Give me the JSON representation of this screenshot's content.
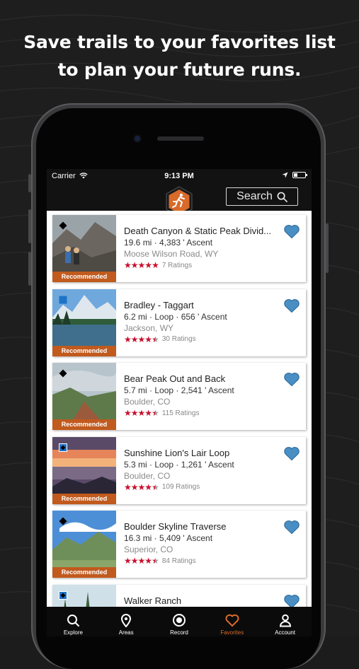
{
  "headline": {
    "line1": "Save trails to your favorites list",
    "line2": "to plan your future runs."
  },
  "status_bar": {
    "carrier": "Carrier",
    "time": "9:13 PM"
  },
  "nav": {
    "search_label": "Search",
    "logo_icon": "trail-run-logo-icon"
  },
  "trails": [
    {
      "name": "Death Canyon & Static Peak Divid...",
      "stats": "19.6 mi  ·  4,383 ' Ascent",
      "location": "Moose Wilson Road, WY",
      "rating": 5,
      "ratings_label": "7 Ratings",
      "badge": "Recommended",
      "difficulty": "black-diamond"
    },
    {
      "name": "Bradley - Taggart",
      "stats": "6.2 mi  ·  Loop  ·  656 ' Ascent",
      "location": "Jackson, WY",
      "rating": 4.5,
      "ratings_label": "30 Ratings",
      "badge": "Recommended",
      "difficulty": "blue-square"
    },
    {
      "name": "Bear Peak Out and Back",
      "stats": "5.7 mi  ·  Loop  ·  2,541 ' Ascent",
      "location": "Boulder, CO",
      "rating": 4.5,
      "ratings_label": "115 Ratings",
      "badge": "Recommended",
      "difficulty": "black-diamond"
    },
    {
      "name": "Sunshine Lion's Lair Loop",
      "stats": "5.3 mi  ·  Loop  ·  1,261 ' Ascent",
      "location": "Boulder, CO",
      "rating": 4.5,
      "ratings_label": "109 Ratings",
      "badge": "Recommended",
      "difficulty": "blue-black"
    },
    {
      "name": "Boulder Skyline Traverse",
      "stats": "16.3 mi  ·  5,409 ' Ascent",
      "location": "Superior, CO",
      "rating": 4.5,
      "ratings_label": "84 Ratings",
      "badge": "Recommended",
      "difficulty": "black-diamond"
    },
    {
      "name": "Walker Ranch",
      "stats": "",
      "location": "",
      "rating": 0,
      "ratings_label": "",
      "badge": "",
      "difficulty": "blue-black"
    }
  ],
  "tabs": [
    {
      "label": "Explore",
      "icon": "search-icon",
      "active": false
    },
    {
      "label": "Areas",
      "icon": "map-pin-icon",
      "active": false
    },
    {
      "label": "Record",
      "icon": "record-icon",
      "active": false
    },
    {
      "label": "Favorites",
      "icon": "heart-icon",
      "active": true
    },
    {
      "label": "Account",
      "icon": "person-icon",
      "active": false
    }
  ],
  "colors": {
    "accent": "#d86a2a",
    "badge": "#c15a1d",
    "heart": "#4a8fc4",
    "stars": "#c8102e",
    "beginner_blue": "#1e73c8"
  }
}
